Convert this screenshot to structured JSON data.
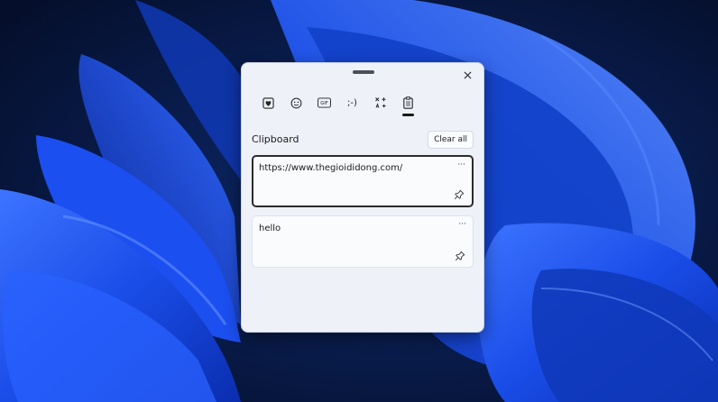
{
  "tabs": [
    {
      "id": "favorites",
      "icon": "heart-sticker-icon"
    },
    {
      "id": "emoji",
      "icon": "smiley-icon"
    },
    {
      "id": "gif",
      "icon": "gif-icon",
      "label": "GIF"
    },
    {
      "id": "kaomoji",
      "icon": "kaomoji-icon",
      "label": ";-)"
    },
    {
      "id": "symbols",
      "icon": "symbols-icon"
    },
    {
      "id": "clipboard",
      "icon": "clipboard-icon",
      "active": true
    }
  ],
  "clipboard": {
    "title": "Clipboard",
    "clear_all_label": "Clear all",
    "items": [
      {
        "text": "https://www.thegioididong.com/",
        "selected": true
      },
      {
        "text": "hello",
        "selected": false
      }
    ],
    "more_label": "···"
  },
  "colors": {
    "panel_bg": "#eef1f8",
    "wallpaper_dark": "#07173f",
    "wallpaper_blue": "#1646e6"
  }
}
